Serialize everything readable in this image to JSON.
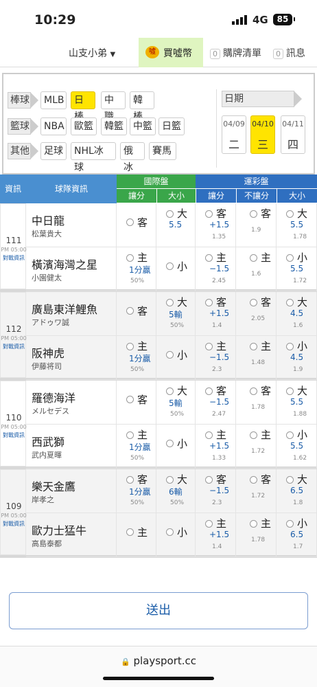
{
  "status": {
    "time": "10:29",
    "network": "4G",
    "battery": "85"
  },
  "topnav": {
    "user": "山支小弟",
    "buy_label": "買噓幣",
    "cart_count": "0",
    "cart_label": "購牌清單",
    "msg_count": "0",
    "msg_label": "訊息"
  },
  "categories": {
    "rows": [
      {
        "label": "棒球",
        "options": [
          "MLB",
          "日棒",
          "中職",
          "韓棒"
        ],
        "selected": "日棒"
      },
      {
        "label": "籃球",
        "options": [
          "NBA",
          "歐籃",
          "韓籃",
          "中籃",
          "日籃"
        ],
        "selected": ""
      },
      {
        "label": "其他",
        "options": [
          "足球",
          "NHL冰球",
          "俄冰",
          "賽馬"
        ],
        "selected": ""
      }
    ],
    "date_label": "日期",
    "dates": [
      {
        "date": "04/09",
        "weekday": "二"
      },
      {
        "date": "04/10",
        "weekday": "三"
      },
      {
        "date": "04/11",
        "weekday": "四"
      }
    ],
    "selected_date": "04/10"
  },
  "table": {
    "header_info": "資訊",
    "header_team": "球隊資訊",
    "header_intl": "國際盤",
    "header_lottery": "運彩盤",
    "sub_handicap": "讓分",
    "sub_total": "大小",
    "sub_lot_handicap": "讓分",
    "sub_no_handicap": "不讓分",
    "sub_lot_total": "大小",
    "games": [
      {
        "num": "111",
        "time": "PM 05:00",
        "link": "對戰資訊",
        "teams": [
          {
            "name": "中日龍",
            "pitcher": "松葉貴大",
            "h": {
              "label": "客",
              "line": "",
              "pct": ""
            },
            "t": {
              "label": "大",
              "line": "5.5",
              "pct": ""
            },
            "lh": {
              "label": "客",
              "line": "+1.5",
              "odds": "1.35"
            },
            "nh": {
              "label": "客",
              "odds": "1.9"
            },
            "lt": {
              "label": "大",
              "line": "5.5",
              "odds": "1.78"
            }
          },
          {
            "name": "橫濱海灣之星",
            "pitcher": "小園健太",
            "h": {
              "label": "主",
              "line": "1分贏",
              "pct": "50%"
            },
            "t": {
              "label": "小",
              "line": "",
              "pct": ""
            },
            "lh": {
              "label": "主",
              "line": "−1.5",
              "odds": "2.45"
            },
            "nh": {
              "label": "主",
              "odds": "1.6"
            },
            "lt": {
              "label": "小",
              "line": "5.5",
              "odds": "1.72"
            }
          }
        ]
      },
      {
        "num": "112",
        "time": "PM 05:00",
        "link": "對戰資訊",
        "teams": [
          {
            "name": "廣島東洋鯉魚",
            "pitcher": "アドゥワ誠",
            "h": {
              "label": "客",
              "line": "",
              "pct": ""
            },
            "t": {
              "label": "大",
              "line": "5輸",
              "pct": "50%"
            },
            "lh": {
              "label": "客",
              "line": "+1.5",
              "odds": "1.4"
            },
            "nh": {
              "label": "客",
              "odds": "2.05"
            },
            "lt": {
              "label": "大",
              "line": "4.5",
              "odds": "1.6"
            }
          },
          {
            "name": "阪神虎",
            "pitcher": "伊藤将司",
            "h": {
              "label": "主",
              "line": "1分贏",
              "pct": "50%"
            },
            "t": {
              "label": "小",
              "line": "",
              "pct": ""
            },
            "lh": {
              "label": "主",
              "line": "−1.5",
              "odds": "2.3"
            },
            "nh": {
              "label": "主",
              "odds": "1.48"
            },
            "lt": {
              "label": "小",
              "line": "4.5",
              "odds": "1.9"
            }
          }
        ]
      },
      {
        "num": "110",
        "time": "PM 05:00",
        "link": "對戰資訊",
        "teams": [
          {
            "name": "羅德海洋",
            "pitcher": "メルセデス",
            "h": {
              "label": "客",
              "line": "",
              "pct": ""
            },
            "t": {
              "label": "大",
              "line": "5輸",
              "pct": "50%"
            },
            "lh": {
              "label": "客",
              "line": "−1.5",
              "odds": "2.47"
            },
            "nh": {
              "label": "客",
              "odds": "1.78"
            },
            "lt": {
              "label": "大",
              "line": "5.5",
              "odds": "1.88"
            }
          },
          {
            "name": "西武獅",
            "pitcher": "武内夏暉",
            "h": {
              "label": "主",
              "line": "1分贏",
              "pct": "50%"
            },
            "t": {
              "label": "小",
              "line": "",
              "pct": ""
            },
            "lh": {
              "label": "主",
              "line": "+1.5",
              "odds": "1.33"
            },
            "nh": {
              "label": "主",
              "odds": "1.72"
            },
            "lt": {
              "label": "小",
              "line": "5.5",
              "odds": "1.62"
            }
          }
        ]
      },
      {
        "num": "109",
        "time": "PM 05:00",
        "link": "對戰資訊",
        "teams": [
          {
            "name": "樂天金鷹",
            "pitcher": "岸孝之",
            "h": {
              "label": "客",
              "line": "1分贏",
              "pct": "50%"
            },
            "t": {
              "label": "大",
              "line": "6輸",
              "pct": "50%"
            },
            "lh": {
              "label": "客",
              "line": "−1.5",
              "odds": "2.3"
            },
            "nh": {
              "label": "客",
              "odds": "1.72"
            },
            "lt": {
              "label": "大",
              "line": "6.5",
              "odds": "1.8"
            }
          },
          {
            "name": "歐力士猛牛",
            "pitcher": "高島泰都",
            "h": {
              "label": "主",
              "line": "",
              "pct": ""
            },
            "t": {
              "label": "小",
              "line": "",
              "pct": ""
            },
            "lh": {
              "label": "主",
              "line": "+1.5",
              "odds": "1.4"
            },
            "nh": {
              "label": "主",
              "odds": "1.78"
            },
            "lt": {
              "label": "小",
              "line": "6.5",
              "odds": "1.7"
            }
          }
        ]
      }
    ]
  },
  "submit_label": "送出",
  "browser": {
    "url": "playsport.cc"
  },
  "colors": {
    "intl_header": "#3aa64a",
    "lottery_header": "#2f6fc0",
    "info_header": "#4a8fd0",
    "selected": "#ffe400",
    "link": "#1a5ca8"
  }
}
